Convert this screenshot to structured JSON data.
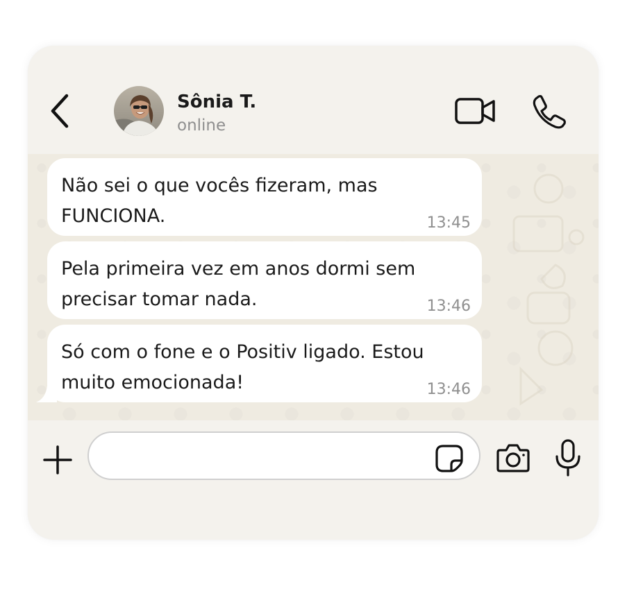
{
  "header": {
    "contact_name": "Sônia T.",
    "contact_status": "online",
    "icons": {
      "back": "chevron-left-icon",
      "video": "video-camera-icon",
      "call": "phone-icon"
    }
  },
  "messages": [
    {
      "lines": [
        "Não sei o que vocês fizeram, mas",
        "FUNCIONA."
      ],
      "time": "13:45"
    },
    {
      "lines": [
        "Pela primeira vez em anos dormi sem",
        "precisar tomar nada."
      ],
      "time": "13:46"
    },
    {
      "lines": [
        "Só com o fone e o Positiv ligado. Estou",
        "muito emocionada!"
      ],
      "time": "13:46"
    }
  ],
  "input_bar": {
    "message_value": "",
    "message_placeholder": "",
    "icons": {
      "add": "plus-icon",
      "sticker": "sticker-icon",
      "camera": "camera-icon",
      "mic": "microphone-icon"
    }
  },
  "colors": {
    "card_background": "#f4f2ed",
    "chat_background": "#efebe1",
    "bubble": "#ffffff",
    "text": "#1a1a1a",
    "muted_text": "#8f8f8f"
  }
}
